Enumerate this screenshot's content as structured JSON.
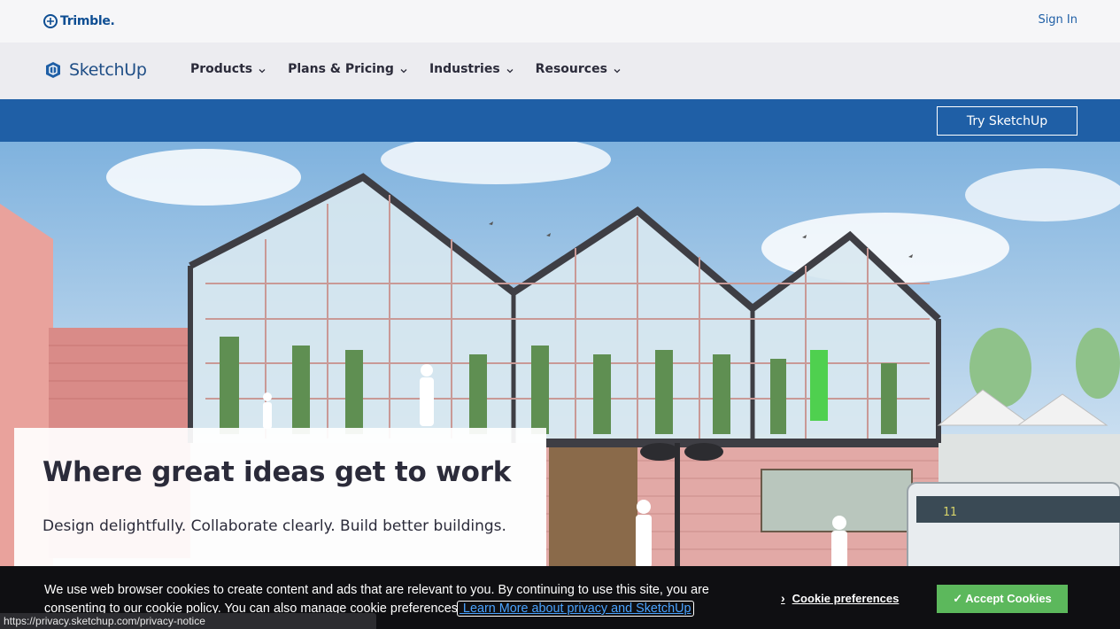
{
  "utility": {
    "logo_text": "Trimble.",
    "sign_in": "Sign In"
  },
  "nav": {
    "logo_text": "SketchUp",
    "items": [
      {
        "label": "Products"
      },
      {
        "label": "Plans & Pricing"
      },
      {
        "label": "Industries"
      },
      {
        "label": "Resources"
      }
    ]
  },
  "cta": {
    "try_label": "Try SketchUp"
  },
  "hero": {
    "title": "Where great ideas get to work",
    "subtitle": "Design delightfully. Collaborate clearly. Build better buildings.",
    "image_desc": "Illustrated rendering of a glass greenhouse building with gabled roofs, vertical plant towers, people silhouettes and a bus"
  },
  "cookie": {
    "text": "We use web browser cookies to create content and ads that are relevant to you. By continuing to use this site, you are consenting to our cookie policy. You can also manage cookie preferences",
    "link_text": " Learn More about privacy and SketchUp ",
    "prefs_label": "Cookie preferences",
    "accept_label": "✓ Accept Cookies"
  },
  "status": {
    "url": "https://privacy.sketchup.com/privacy-notice"
  },
  "colors": {
    "brand_blue": "#1f5fa6",
    "accept_green": "#5cb85c",
    "banner_bg": "#0f0f12"
  }
}
